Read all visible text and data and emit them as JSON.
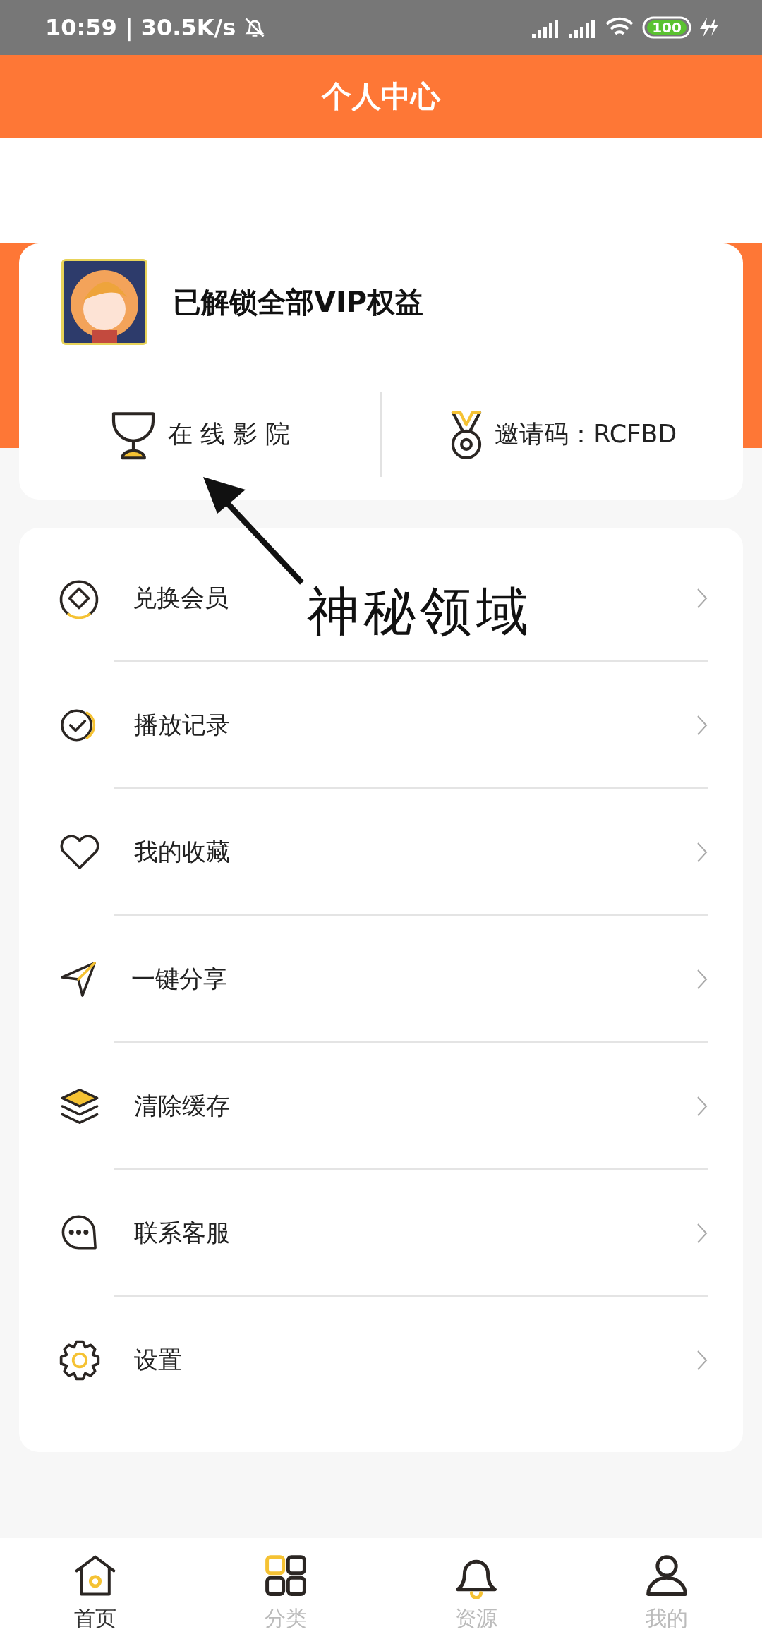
{
  "status_bar": {
    "time": "10:59 | 30.5K/s",
    "battery": "100"
  },
  "header": {
    "title": "个人中心"
  },
  "profile": {
    "title": "已解锁全部VIP权益",
    "links": [
      {
        "kind": "cinema",
        "label": "在 线 影 院"
      },
      {
        "kind": "invite",
        "label": "邀请码：RCFBD"
      }
    ]
  },
  "annotation": {
    "text": "神秘领域"
  },
  "menu": [
    {
      "kind": "redeem",
      "label": "兑换会员"
    },
    {
      "kind": "history",
      "label": "播放记录"
    },
    {
      "kind": "favorite",
      "label": "我的收藏"
    },
    {
      "kind": "share",
      "label": "一键分享"
    },
    {
      "kind": "cache",
      "label": "清除缓存"
    },
    {
      "kind": "service",
      "label": "联系客服"
    },
    {
      "kind": "settings",
      "label": "设置"
    }
  ],
  "tabs": [
    {
      "kind": "home",
      "label": "首页",
      "selected": true
    },
    {
      "kind": "category",
      "label": "分类",
      "selected": false
    },
    {
      "kind": "resource",
      "label": "资源",
      "selected": false
    },
    {
      "kind": "mine",
      "label": "我的",
      "selected": false
    }
  ]
}
